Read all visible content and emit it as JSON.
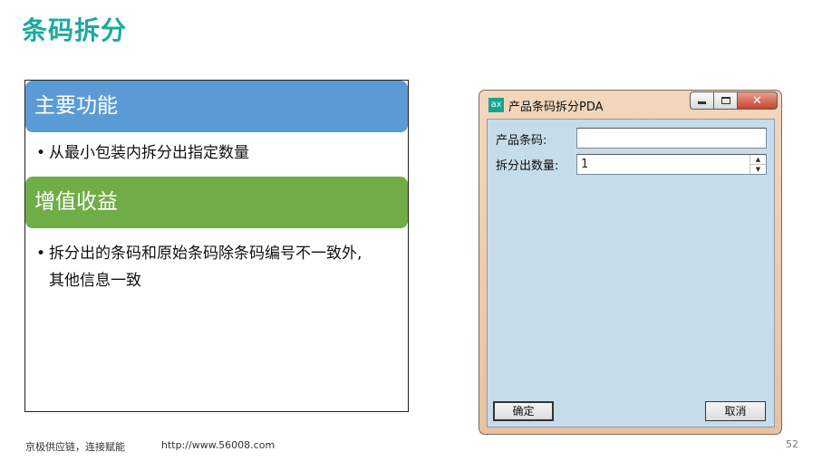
{
  "slide": {
    "title": "条码拆分",
    "section1": {
      "heading": "主要功能",
      "bullet_marker": "•",
      "bullet": "从最小包装内拆分出指定数量"
    },
    "section2": {
      "heading": "增值收益",
      "bullet_marker": "•",
      "bullet_line1": "拆分出的条码和原始条码除条码编号不一致外,",
      "bullet_line2": "其他信息一致"
    },
    "footer": {
      "tagline": "京极供应链，连接赋能",
      "url": "http://www.56008.com",
      "page_number": "52"
    }
  },
  "dialog": {
    "app_icon_text": "ax",
    "title": "产品条码拆分PDA",
    "window_buttons": {
      "close_symbol": "✕"
    },
    "fields": {
      "barcode_label": "产品条码:",
      "barcode_value": "",
      "quantity_label": "拆分出数量:",
      "quantity_value": "1",
      "spin_up": "▲",
      "spin_down": "▼"
    },
    "buttons": {
      "ok": "确定",
      "cancel": "取消"
    }
  },
  "colors": {
    "title": "#1aaa9e",
    "band_blue": "#5b9bd5",
    "band_green": "#70ad47",
    "dialog_frame": "#e8c2a0",
    "dialog_client": "#c6dceb"
  }
}
